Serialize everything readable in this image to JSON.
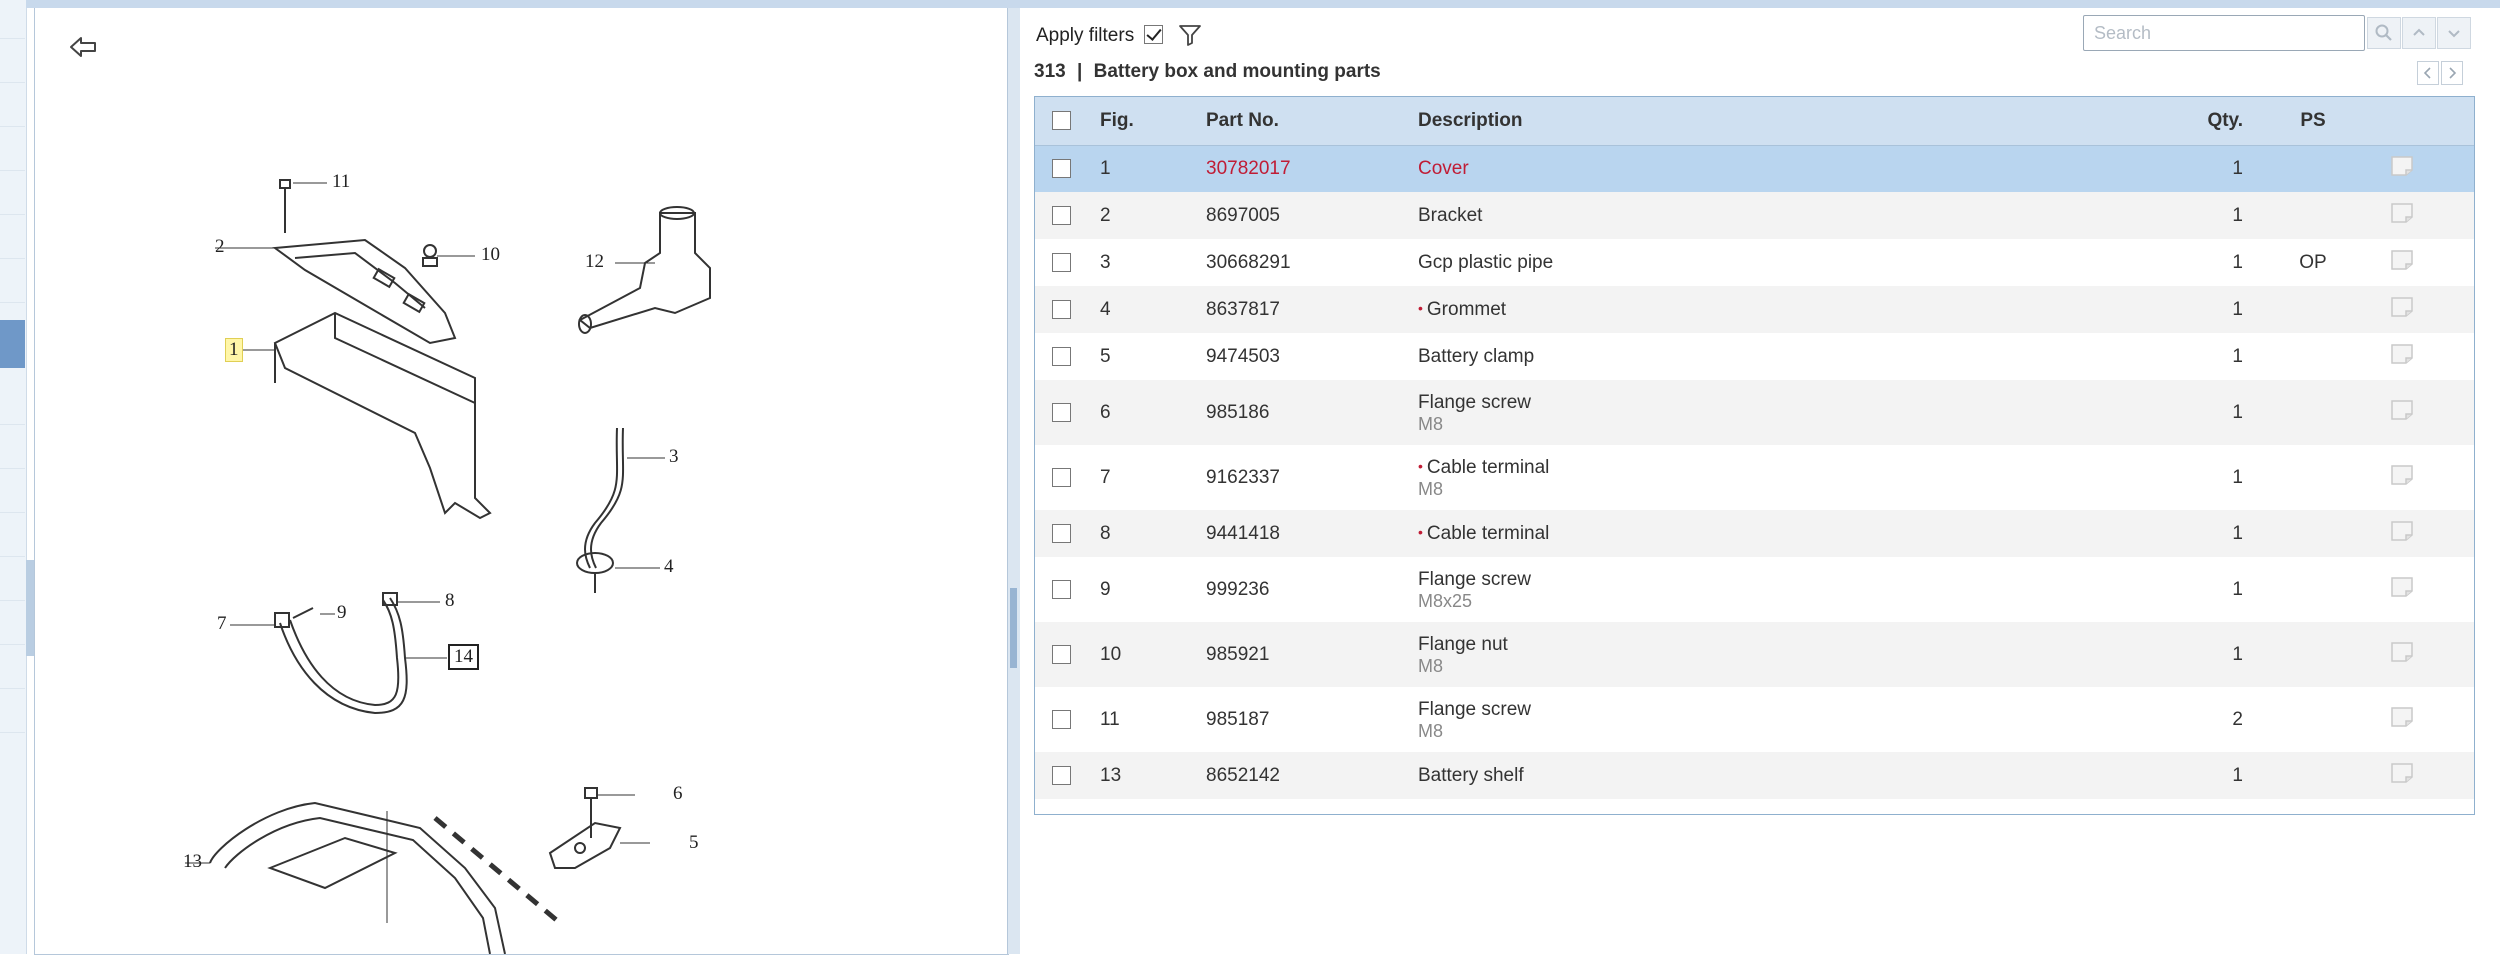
{
  "app": {
    "back_label": "back"
  },
  "diagram": {
    "callouts": [
      "11",
      "2",
      "10",
      "12",
      "1",
      "3",
      "4",
      "7",
      "9",
      "8",
      "14",
      "6",
      "5",
      "13"
    ]
  },
  "toolbar": {
    "apply_filters_label": "Apply filters",
    "apply_filters_checked": true,
    "filter_icon": "filter-icon",
    "search_placeholder": "Search",
    "search_value": "",
    "search_icon": "search-icon",
    "prev_icon": "chevron-up-icon",
    "next_icon": "chevron-down-icon"
  },
  "group": {
    "number": "313",
    "separator": "|",
    "title": "Battery box and mounting parts",
    "prev_icon": "chevron-left-icon",
    "next_icon": "chevron-right-icon"
  },
  "table": {
    "headers": {
      "select": "",
      "fig": "Fig.",
      "part_no": "Part No.",
      "description": "Description",
      "qty": "Qty.",
      "ps": "PS",
      "note": ""
    },
    "rows": [
      {
        "fig": "1",
        "part_no": "30782017",
        "description": "Cover",
        "sub": "",
        "qty": "1",
        "ps": "",
        "bullet": false,
        "selected": true
      },
      {
        "fig": "2",
        "part_no": "8697005",
        "description": "Bracket",
        "sub": "",
        "qty": "1",
        "ps": "",
        "bullet": false
      },
      {
        "fig": "3",
        "part_no": "30668291",
        "description": "Gcp plastic pipe",
        "sub": "",
        "qty": "1",
        "ps": "OP",
        "bullet": false
      },
      {
        "fig": "4",
        "part_no": "8637817",
        "description": "Grommet",
        "sub": "",
        "qty": "1",
        "ps": "",
        "bullet": true
      },
      {
        "fig": "5",
        "part_no": "9474503",
        "description": "Battery clamp",
        "sub": "",
        "qty": "1",
        "ps": "",
        "bullet": false
      },
      {
        "fig": "6",
        "part_no": "985186",
        "description": "Flange screw",
        "sub": "M8",
        "qty": "1",
        "ps": "",
        "bullet": false
      },
      {
        "fig": "7",
        "part_no": "9162337",
        "description": "Cable terminal",
        "sub": "M8",
        "qty": "1",
        "ps": "",
        "bullet": true
      },
      {
        "fig": "8",
        "part_no": "9441418",
        "description": "Cable terminal",
        "sub": "",
        "qty": "1",
        "ps": "",
        "bullet": true
      },
      {
        "fig": "9",
        "part_no": "999236",
        "description": "Flange screw",
        "sub": "M8x25",
        "qty": "1",
        "ps": "",
        "bullet": false
      },
      {
        "fig": "10",
        "part_no": "985921",
        "description": "Flange nut",
        "sub": "M8",
        "qty": "1",
        "ps": "",
        "bullet": false
      },
      {
        "fig": "11",
        "part_no": "985187",
        "description": "Flange screw",
        "sub": "M8",
        "qty": "2",
        "ps": "",
        "bullet": false
      },
      {
        "fig": "13",
        "part_no": "8652142",
        "description": "Battery shelf",
        "sub": "",
        "qty": "1",
        "ps": "",
        "bullet": false
      }
    ],
    "note_icon": "note-icon",
    "bullet_char": "•"
  },
  "colors": {
    "header_bg": "#cfe0f1",
    "selected_row_bg": "#b9d5ef",
    "selected_text": "#c01c35",
    "bullet": "#c01c35"
  }
}
